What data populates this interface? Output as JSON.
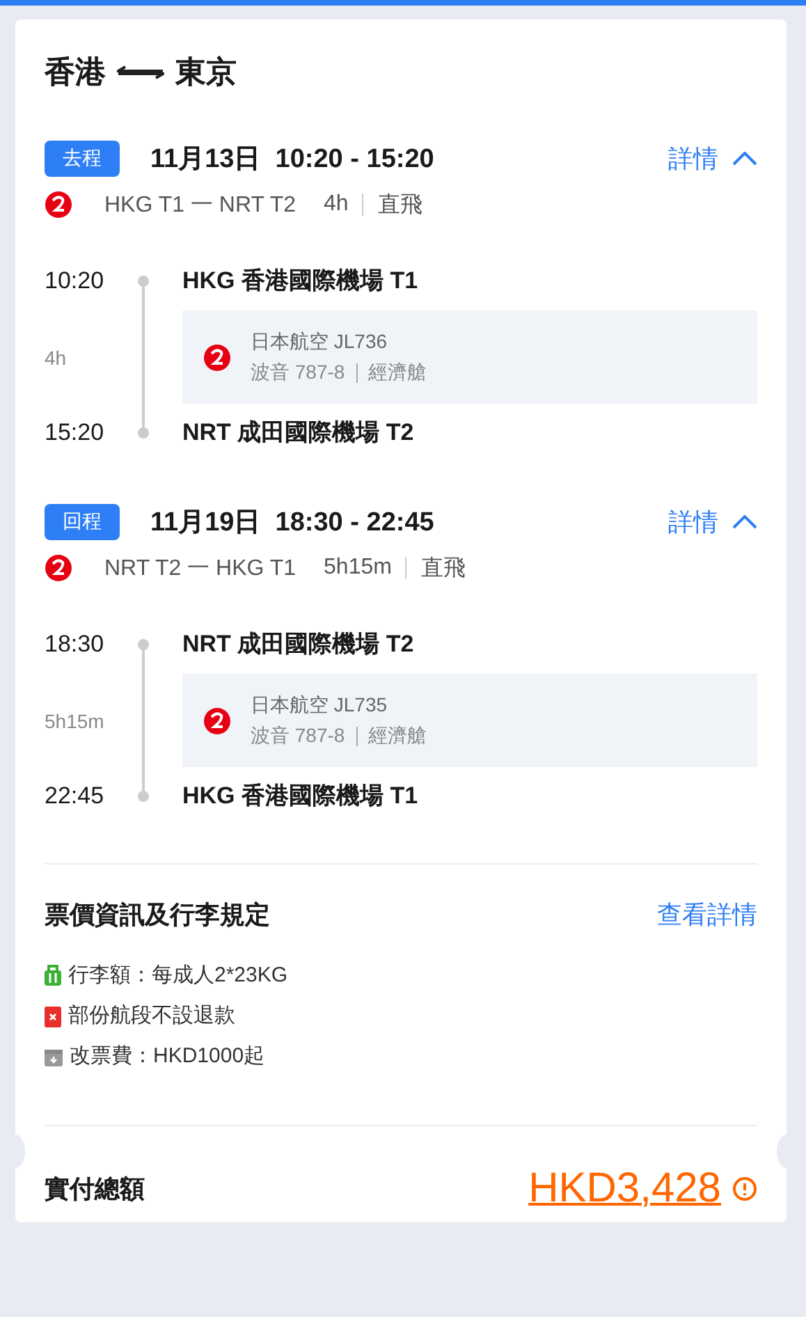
{
  "title": {
    "origin": "香港",
    "destination": "東京"
  },
  "legs": [
    {
      "tag": "去程",
      "date_time": "11月13日  10:20 - 15:20",
      "details_link": "詳情",
      "expanded": true,
      "route": "HKG T1 一 NRT T2",
      "duration": "4h",
      "flight_type": "直飛",
      "departure_time": "10:20",
      "departure_airport": "HKG 香港國際機場 T1",
      "segment_duration": "4h",
      "airline_flight": "日本航空 JL736",
      "aircraft": "波音 787-8",
      "cabin": "經濟艙",
      "arrival_time": "15:20",
      "arrival_airport": "NRT 成田國際機場 T2"
    },
    {
      "tag": "回程",
      "date_time": "11月19日  18:30 - 22:45",
      "details_link": "詳情",
      "expanded": true,
      "route": "NRT T2 一 HKG T1",
      "duration": "5h15m",
      "flight_type": "直飛",
      "departure_time": "18:30",
      "departure_airport": "NRT 成田國際機場 T2",
      "segment_duration": "5h15m",
      "airline_flight": "日本航空 JL735",
      "aircraft": "波音 787-8",
      "cabin": "經濟艙",
      "arrival_time": "22:45",
      "arrival_airport": "HKG 香港國際機場 T1"
    }
  ],
  "fare_rules": {
    "title": "票價資訊及行李規定",
    "link": "查看詳情",
    "items": [
      {
        "kind": "baggage",
        "text": "行李額：每成人2*23KG"
      },
      {
        "kind": "refund",
        "text": "部份航段不設退款"
      },
      {
        "kind": "change",
        "text": "改票費：HKD1000起"
      }
    ]
  },
  "total": {
    "label": "實付總額",
    "amount": "HKD3,428"
  }
}
